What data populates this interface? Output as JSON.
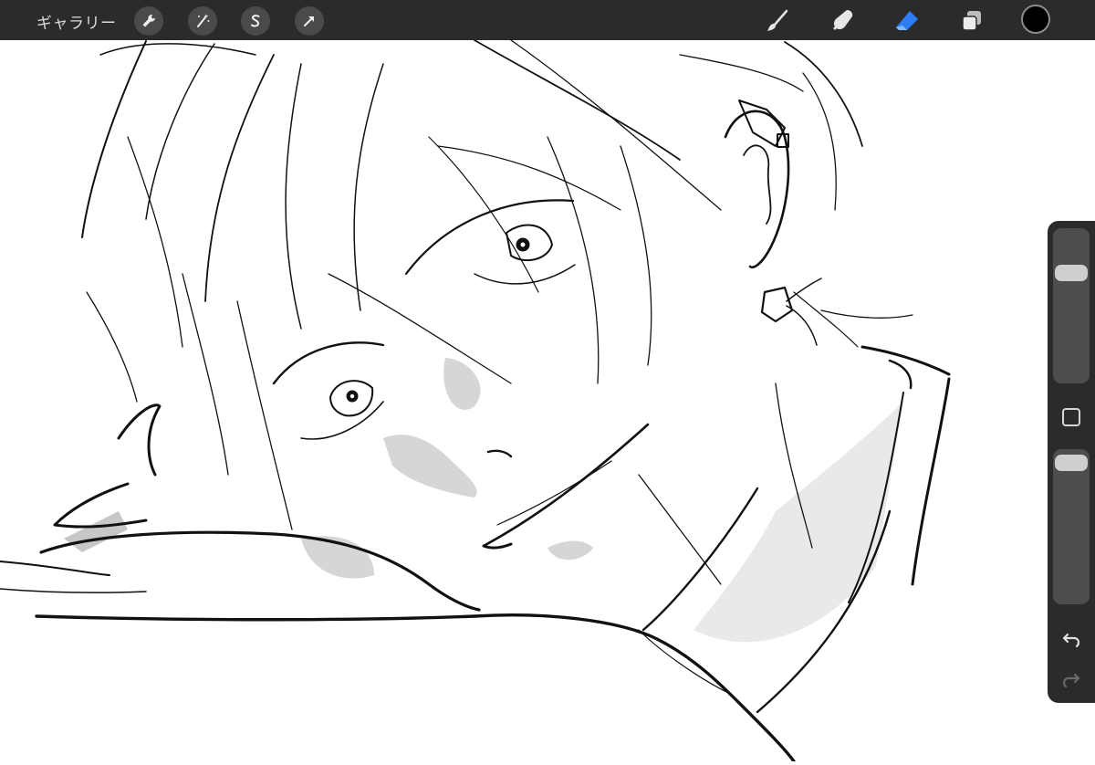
{
  "topbar": {
    "gallery_label": "ギャラリー"
  },
  "tools_left": [
    "wrench-icon",
    "magic-wand-icon",
    "selection-s-icon",
    "transform-arrow-icon"
  ],
  "tools_right": [
    "brush-icon",
    "smudge-icon",
    "eraser-icon",
    "layers-icon"
  ],
  "colors": {
    "topbar_bg": "#2b2b2b",
    "active_tool": "#2f7df6",
    "current_color": "#000000"
  },
  "sidebar": {
    "brush_size_level": 0.88,
    "opacity_level": 1.0
  }
}
